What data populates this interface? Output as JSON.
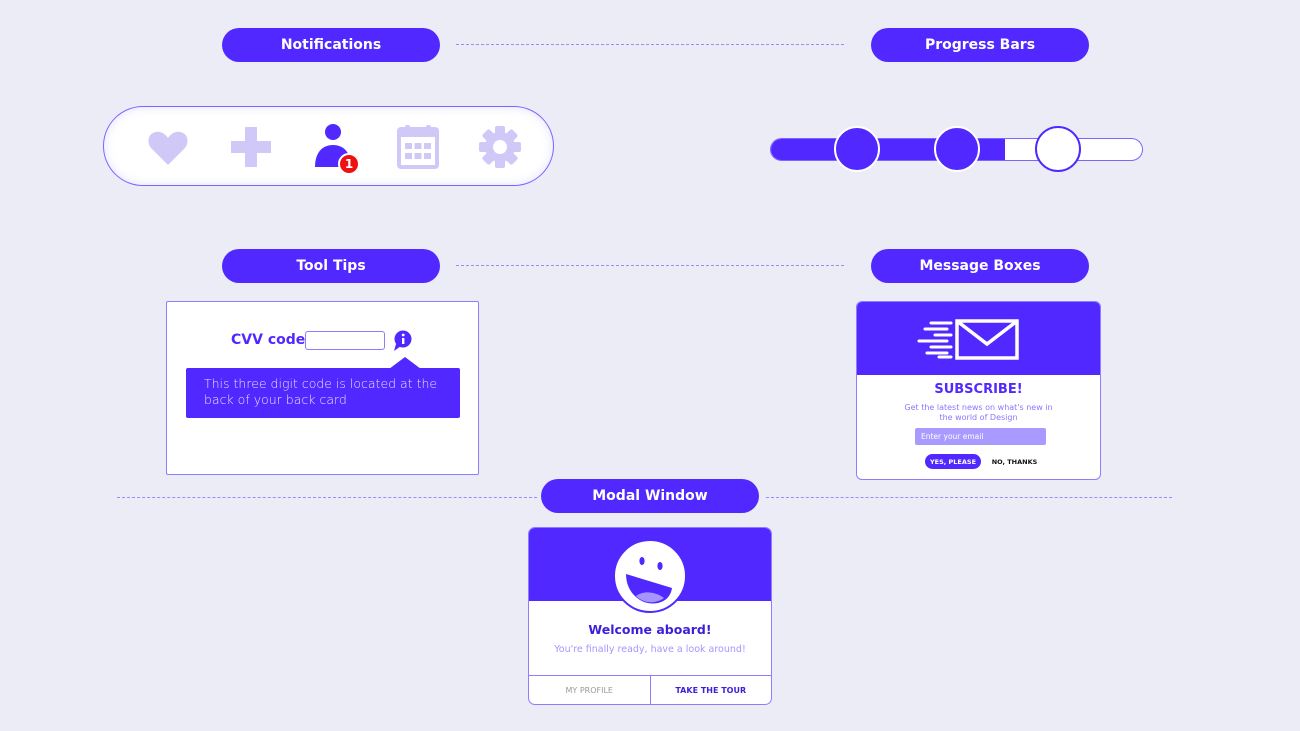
{
  "sections": {
    "notifications": "Notifications",
    "progress_bars": "Progress Bars",
    "tool_tips": "Tool Tips",
    "message_boxes": "Message Boxes",
    "modal_window": "Modal Window"
  },
  "notifications": {
    "icons": [
      "heart-icon",
      "plus-icon",
      "user-icon",
      "calendar-icon",
      "gear-icon"
    ],
    "active_icon": "user-icon",
    "badge_count": "1",
    "colors": {
      "active": "#5128ff",
      "inactive": "#d0c8f7",
      "badge": "#ee1111"
    }
  },
  "progress": {
    "steps_total": 3,
    "steps_completed": 2,
    "fill_percent": 63
  },
  "tooltip": {
    "label": "CVV code",
    "input_value": "",
    "info_icon": "info-icon",
    "text": "This three digit code is located at the back of your back card"
  },
  "message_box": {
    "icon": "envelope-icon",
    "title": "SUBSCRIBE!",
    "subtitle": "Get the latest news on what's new in the world of Design",
    "email_placeholder": "Enter your email",
    "yes_label": "YES, PLEASE",
    "no_label": "NO, THANKS"
  },
  "modal": {
    "icon": "smiley-icon",
    "title": "Welcome aboard!",
    "subtitle": "You're finally ready, have a look around!",
    "left_button": "MY PROFILE",
    "right_button": "TAKE THE TOUR"
  },
  "colors": {
    "brand": "#5128ff",
    "background": "#ececf7"
  }
}
